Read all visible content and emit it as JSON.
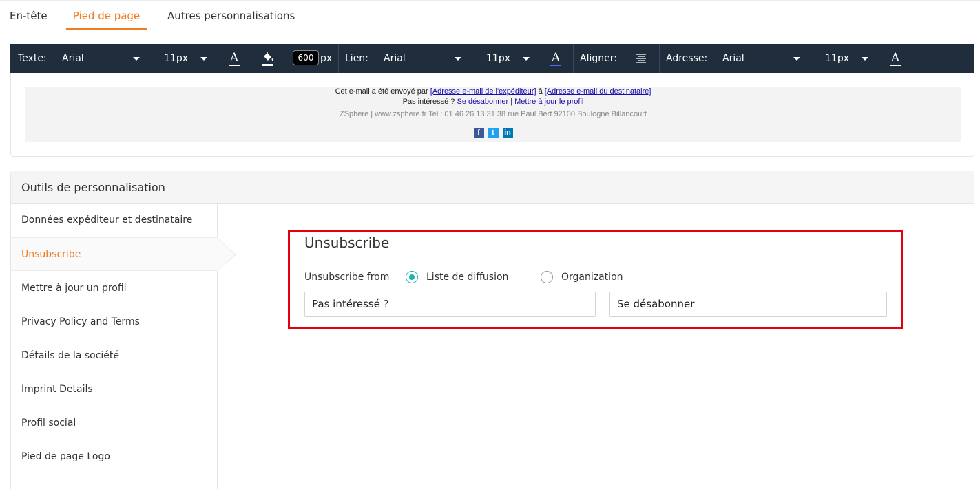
{
  "tabs": [
    "En-tête",
    "Pied de page",
    "Autres personnalisations"
  ],
  "active_tab": "Pied de page",
  "toolbar": {
    "text_label": "Texte:",
    "text_font": "Arial",
    "text_size": "11px",
    "width_value": "600",
    "width_unit": "px",
    "link_label": "Lien:",
    "link_font": "Arial",
    "link_size": "11px",
    "align_label": "Aligner:",
    "address_label": "Adresse:",
    "address_font": "Arial",
    "address_size": "11px",
    "icons": [
      "font-color-icon",
      "fill-color-icon",
      "align-center-icon"
    ]
  },
  "preview": {
    "line1_prefix": "Cet e-mail a été envoyé par",
    "sender_link": "[Adresse e-mail de l'expéditeur]",
    "line1_mid": "à",
    "recipient_link": "[Adresse e-mail du destinataire]",
    "line2_prefix": "Pas intéressé ?",
    "unsubscribe_link": "Se désabonner",
    "line2_sep": "|",
    "update_link": "Mettre à jour le profil",
    "address_line": "ZSphere | www.zsphere.fr Tel : 01 46 26 13 31 38 rue Paul Bert 92100 Boulogne Billancourt",
    "social_icons": [
      "facebook-icon",
      "twitter-icon",
      "linkedin-icon"
    ]
  },
  "tools": {
    "title": "Outils de personnalisation",
    "items": [
      "Données expéditeur et destinataire",
      "Unsubscribe",
      "Mettre à jour un profil",
      "Privacy Policy and Terms",
      "Détails de la société",
      "Imprint Details",
      "Profil social",
      "Pied de page Logo"
    ],
    "active_item": "Unsubscribe"
  },
  "form": {
    "title": "Unsubscribe",
    "from_label": "Unsubscribe from",
    "options": [
      "Liste de diffusion",
      "Organization"
    ],
    "selected_option": "Liste de diffusion",
    "text_value": "Pas intéressé ?",
    "link_value": "Se désabonner"
  },
  "colors": {
    "accent": "#ef7b22",
    "toolbar_bg": "#1f2d3d",
    "radio_selected": "#1ab5b4",
    "highlight_border": "#e5000f",
    "link": "#1a0dab"
  }
}
